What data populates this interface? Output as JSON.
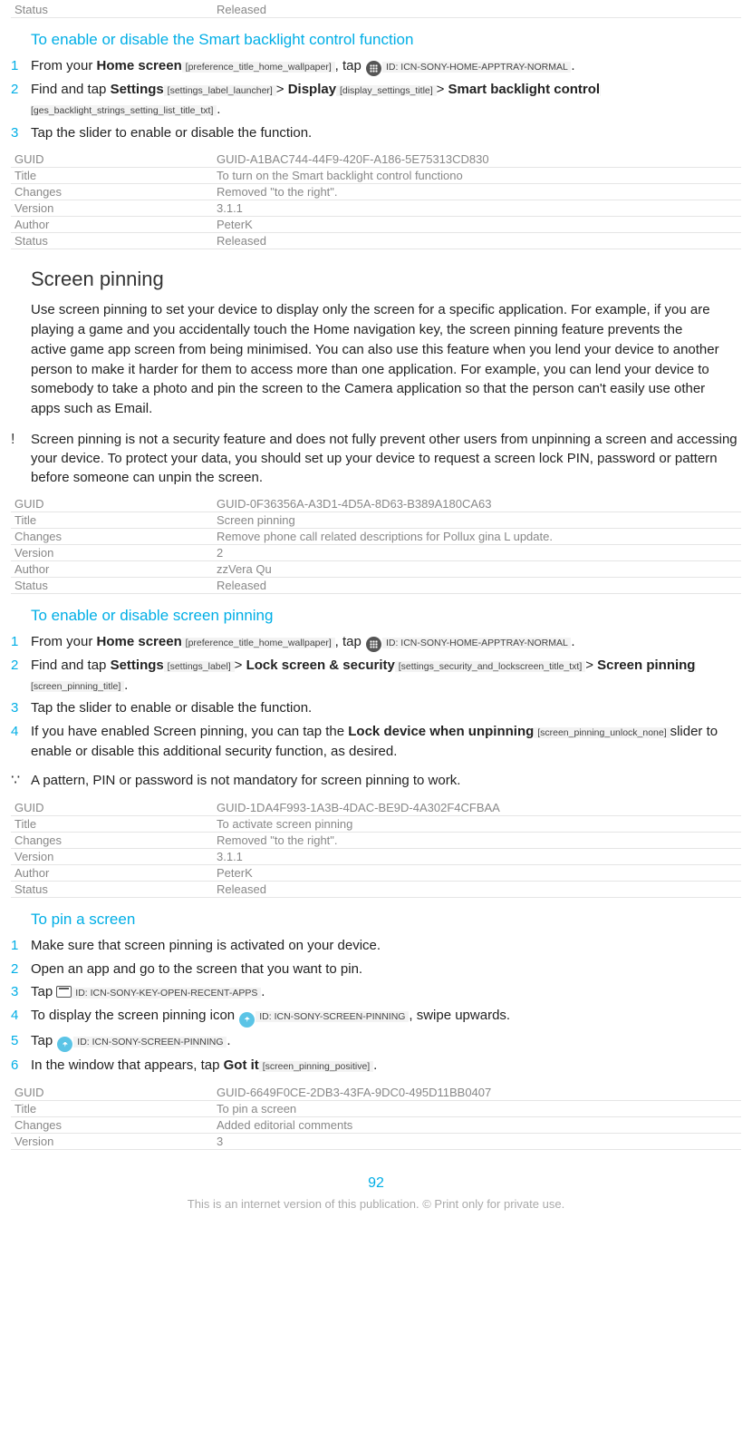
{
  "topMeta": {
    "rows": [
      {
        "k": "Status",
        "v": "Released"
      }
    ]
  },
  "sec1": {
    "heading": "To enable or disable the Smart backlight control function",
    "step1_a": "From your ",
    "step1_home": "Home screen",
    "step1_home_tag": " [preference_title_home_wallpaper] ",
    "step1_b": ", tap ",
    "step1_icon_id": " ID: ICN-SONY-HOME-APPTRAY-NORMAL ",
    "step1_c": ".",
    "step2_a": "Find and tap ",
    "step2_settings": "Settings",
    "step2_settings_tag": " [settings_label_launcher] ",
    "step2_gt1": " > ",
    "step2_display": "Display",
    "step2_display_tag": " [display_settings_title] ",
    "step2_gt2": " > ",
    "step2_smart": "Smart backlight control",
    "step2_smart_tag": " [ges_backlight_strings_setting_list_title_txt] ",
    "step2_c": ".",
    "step3": "Tap the slider to enable or disable the function."
  },
  "meta1": {
    "rows": [
      {
        "k": "GUID",
        "v": "GUID-A1BAC744-44F9-420F-A186-5E75313CD830"
      },
      {
        "k": "Title",
        "v": "To turn on the Smart backlight control functiono"
      },
      {
        "k": "Changes",
        "v": "Removed \"to the right\"."
      },
      {
        "k": "Version",
        "v": "3.1.1"
      },
      {
        "k": "Author",
        "v": "PeterK"
      },
      {
        "k": "Status",
        "v": "Released"
      }
    ]
  },
  "sec2": {
    "heading": "Screen pinning",
    "para": "Use screen pinning to set your device to display only the screen for a specific application. For example, if you are playing a game and you accidentally touch the Home navigation key, the screen pinning feature prevents the active game app screen from being minimised. You can also use this feature when you lend your device to another person to make it harder for them to access more than one application. For example, you can lend your device to somebody to take a photo and pin the screen to the Camera application so that the person can't easily use other apps such as Email.",
    "note": "Screen pinning is not a security feature and does not fully prevent other users from unpinning a screen and accessing your device. To protect your data, you should set up your device to request a screen lock PIN, password or pattern before someone can unpin the screen."
  },
  "meta2": {
    "rows": [
      {
        "k": "GUID",
        "v": "GUID-0F36356A-A3D1-4D5A-8D63-B389A180CA63"
      },
      {
        "k": "Title",
        "v": "Screen pinning"
      },
      {
        "k": "Changes",
        "v": "Remove phone call related descriptions for Pollux gina L update."
      },
      {
        "k": "Version",
        "v": "2"
      },
      {
        "k": "Author",
        "v": "zzVera Qu"
      },
      {
        "k": "Status",
        "v": "Released"
      }
    ]
  },
  "sec3": {
    "heading": "To enable or disable screen pinning",
    "step1_a": "From your ",
    "step1_home": "Home screen",
    "step1_home_tag": " [preference_title_home_wallpaper] ",
    "step1_b": ", tap ",
    "step1_icon_id": " ID: ICN-SONY-HOME-APPTRAY-NORMAL ",
    "step1_c": ".",
    "step2_a": "Find and tap ",
    "step2_settings": "Settings",
    "step2_settings_tag": " [settings_label] ",
    "step2_gt1": " > ",
    "step2_lock": "Lock screen & security",
    "step2_lock_tag": " [settings_security_and_lockscreen_title_txt] ",
    "step2_gt2": " > ",
    "step2_pin": "Screen pinning",
    "step2_pin_tag": " [screen_pinning_title] ",
    "step2_c": ".",
    "step3": "Tap the slider to enable or disable the function.",
    "step4_a": "If you have enabled Screen pinning, you can tap the ",
    "step4_lock": "Lock device when unpinning",
    "step4_lock_tag": " [screen_pinning_unlock_none] ",
    "step4_b": " slider to enable or disable this additional security function, as desired.",
    "tip": "A pattern, PIN or password is not mandatory for screen pinning to work."
  },
  "meta3": {
    "rows": [
      {
        "k": "GUID",
        "v": "GUID-1DA4F993-1A3B-4DAC-BE9D-4A302F4CFBAA"
      },
      {
        "k": "Title",
        "v": "To activate screen pinning"
      },
      {
        "k": "Changes",
        "v": "Removed \"to the right\"."
      },
      {
        "k": "Version",
        "v": "3.1.1"
      },
      {
        "k": "Author",
        "v": "PeterK"
      },
      {
        "k": "Status",
        "v": "Released"
      }
    ]
  },
  "sec4": {
    "heading": "To pin a screen",
    "step1": "Make sure that screen pinning is activated on your device.",
    "step2": "Open an app and go to the screen that you want to pin.",
    "step3_a": "Tap ",
    "step3_icon_id": " ID: ICN-SONY-KEY-OPEN-RECENT-APPS ",
    "step3_b": ".",
    "step4_a": "To display the screen pinning icon ",
    "step4_icon_id": " ID: ICN-SONY-SCREEN-PINNING ",
    "step4_b": ", swipe upwards.",
    "step5_a": "Tap ",
    "step5_icon_id": " ID: ICN-SONY-SCREEN-PINNING ",
    "step5_b": ".",
    "step6_a": "In the window that appears, tap ",
    "step6_got": "Got it",
    "step6_got_tag": " [screen_pinning_positive] ",
    "step6_b": "."
  },
  "meta4": {
    "rows": [
      {
        "k": "GUID",
        "v": "GUID-6649F0CE-2DB3-43FA-9DC0-495D11BB0407"
      },
      {
        "k": "Title",
        "v": "To pin a screen"
      },
      {
        "k": "Changes",
        "v": "Added editorial comments"
      },
      {
        "k": "Version",
        "v": "3"
      }
    ]
  },
  "page": "92",
  "footer": "This is an internet version of this publication. © Print only for private use."
}
